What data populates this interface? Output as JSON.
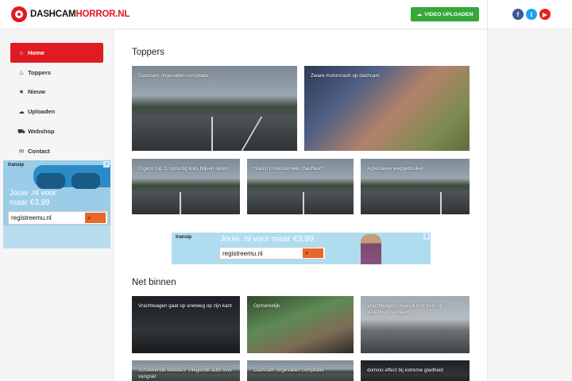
{
  "header": {
    "logo_part1": "DASHCAM",
    "logo_part2": "HORROR.NL",
    "upload_label": "VIDEO UPLOADEN",
    "upload_icon": "cloud-upload-icon",
    "socials": [
      {
        "name": "facebook-icon",
        "glyph": "f",
        "color": "#3b5998"
      },
      {
        "name": "twitter-icon",
        "glyph": "t",
        "color": "#1da1f2"
      },
      {
        "name": "youtube-icon",
        "glyph": "▶",
        "color": "#e62117"
      }
    ]
  },
  "sidebar": {
    "items": [
      {
        "label": "Home",
        "icon": "home-icon",
        "glyph": "⌂",
        "active": true
      },
      {
        "label": "Toppers",
        "icon": "flame-icon",
        "glyph": "♨",
        "active": false
      },
      {
        "label": "Nieuw",
        "icon": "star-icon",
        "glyph": "★",
        "active": false
      },
      {
        "label": "Uploaden",
        "icon": "cloud-upload-icon",
        "glyph": "☁",
        "active": false
      },
      {
        "label": "Webshop",
        "icon": "cart-icon",
        "glyph": "⛟",
        "active": false
      },
      {
        "label": "Contact",
        "icon": "envelope-icon",
        "glyph": "✉",
        "active": false
      }
    ]
  },
  "side_ad": {
    "brand": "transip",
    "line1": "Jouw .nl voor",
    "line2": "maar €3,99",
    "input_value": "registreemu.nl",
    "close": "x"
  },
  "main": {
    "toppers_title": "Toppers",
    "toppers": [
      "Dashcam ongevallen compilatie",
      "Zware motorcrash op dashcam",
      "Ergens top 3, onnodig links blijven rijden",
      "Hoezo professioneel chauffeur?",
      "Agressieve weggebruiker"
    ],
    "mid_ad": {
      "brand": "transip",
      "line": "Jouw .nl voor maar €3,99",
      "input_value": "registreemu.nl",
      "close": "x"
    },
    "net_binnen_title": "Net binnen",
    "net_binnen": [
      "Vrachtwagen gaat op snelweg op zijn kant",
      "Opmerkelijk",
      "Vrachtwagen ongeval met trein op spoorwegovergang",
      "Schokkende beelden! Vliegende auto over vangrail",
      "Dashcam ongevallen compilatie",
      "domino effect bij extreme gladheid"
    ]
  },
  "colors": {
    "brand_red": "#e01b22",
    "upload_green": "#34a93a",
    "ad_orange": "#e8672b"
  }
}
